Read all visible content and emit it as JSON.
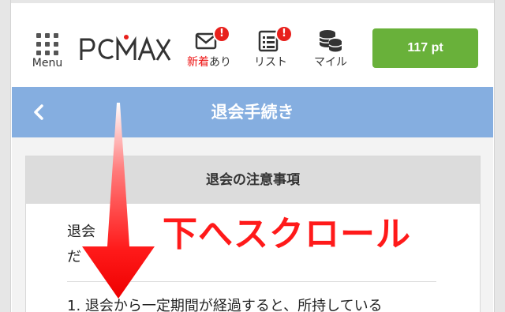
{
  "header": {
    "menu_label": "Menu",
    "logo_text": "PCMAX",
    "nav": [
      {
        "icon": "envelope-icon",
        "label_red": "新着",
        "label": "あり",
        "badge": "!"
      },
      {
        "icon": "list-icon",
        "label": "リスト",
        "badge": "!"
      },
      {
        "icon": "coins-icon",
        "label": "マイル"
      }
    ],
    "points_label": "117 pt"
  },
  "title_bar": {
    "back_icon": "chevron-left-icon",
    "title": "退会手続き"
  },
  "card": {
    "heading": "退会の注意事項",
    "para_line1": "退会",
    "para_line2": "だ",
    "list_item_1": "1. 退会から一定期間が経過すると、所持している"
  },
  "overlay": {
    "annotation": "下へスクロール",
    "arrow_icon": "down-arrow-icon"
  },
  "colors": {
    "title_bar": "#85aee0",
    "points_button": "#69b13a",
    "badge": "#e8201c",
    "annotation": "#ff1a1a"
  }
}
